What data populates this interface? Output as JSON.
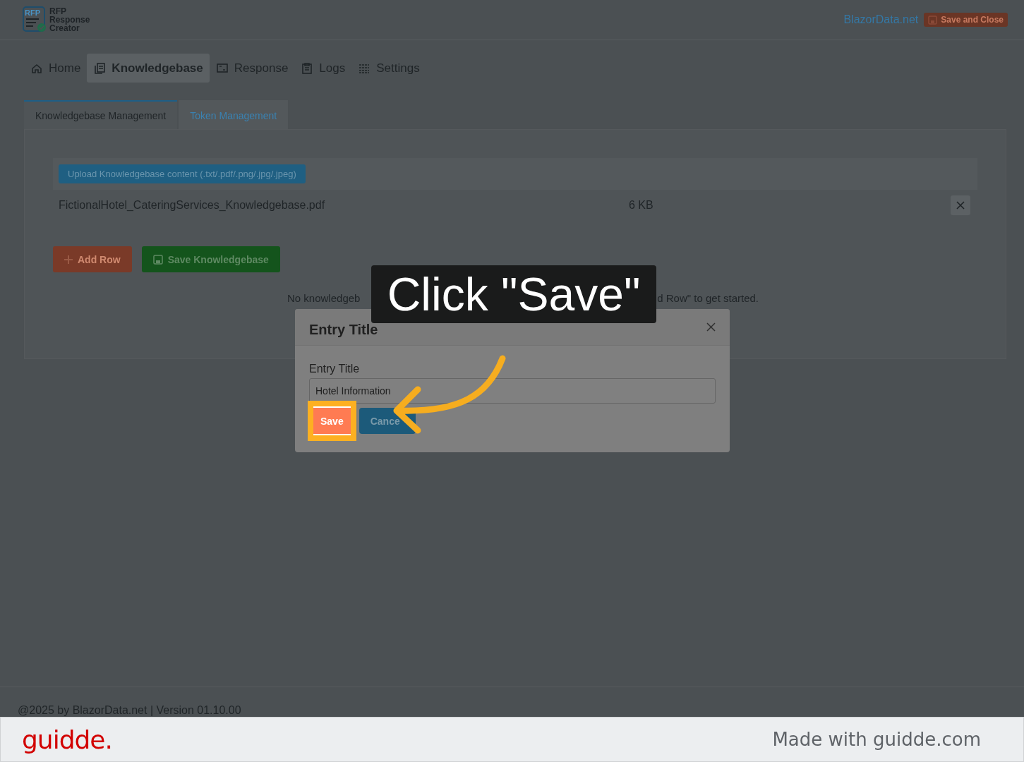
{
  "header": {
    "logo_badge": "RFP",
    "logo_lines": [
      "RFP",
      "Response",
      "Creator"
    ],
    "link": "BlazorData.net",
    "button": "Save and Close"
  },
  "nav": [
    {
      "label": "Home",
      "selected": false
    },
    {
      "label": "Knowledgebase",
      "selected": true
    },
    {
      "label": "Response",
      "selected": false
    },
    {
      "label": "Logs",
      "selected": false
    },
    {
      "label": "Settings",
      "selected": false
    }
  ],
  "tabs": [
    {
      "label": "Knowledgebase Management",
      "selected": true
    },
    {
      "label": "Token Management",
      "selected": false
    }
  ],
  "upload_button": "Upload Knowledgebase content (.txt/.pdf/.png/.jpg/.jpeg)",
  "files": [
    {
      "name": "FictionalHotel_CateringServices_Knowledgebase.pdf",
      "size": "6 KB"
    }
  ],
  "actions": {
    "add_row": "Add Row",
    "save": "Save Knowledgebase"
  },
  "empty_message": [
    "No knowledgeb",
    "d Row\" to get started."
  ],
  "modal": {
    "title": "Entry Title",
    "field_label": "Entry Title",
    "field_value": "Hotel Information",
    "save": "Save",
    "cancel": "Cance",
    "save_highlighted": true
  },
  "callout": "Click \"Save\"",
  "footer": "@2025 by BlazorData.net | Version 01.10.00",
  "guidde": {
    "logo": "guidde.",
    "credit": "Made with guidde.com"
  }
}
